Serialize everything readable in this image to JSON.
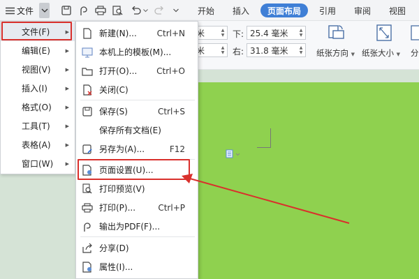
{
  "toolbar": {
    "file_label": "文件",
    "tabs": [
      "开始",
      "插入",
      "页面布局",
      "引用",
      "审阅",
      "视图"
    ],
    "active_tab": "页面布局",
    "accent_color": "#3f7fd6"
  },
  "ribbon": {
    "margin_top_value": "米",
    "margin_bottom_label": "下:",
    "margin_bottom_value": "25.4 毫米",
    "margin_left_value": "米",
    "margin_right_label": "右:",
    "margin_right_value": "31.8 毫米",
    "paper_orientation_label": "纸张方向",
    "paper_size_label": "纸张大小",
    "columns_label": "分"
  },
  "menu": {
    "items": [
      {
        "label": "文件(F)",
        "icon": "chevron-right"
      },
      {
        "label": "编辑(E)",
        "icon": "chevron-right"
      },
      {
        "label": "视图(V)",
        "icon": "chevron-right"
      },
      {
        "label": "插入(I)",
        "icon": "chevron-right"
      },
      {
        "label": "格式(O)",
        "icon": "chevron-right"
      },
      {
        "label": "工具(T)",
        "icon": "chevron-right"
      },
      {
        "label": "表格(A)",
        "icon": "chevron-right"
      },
      {
        "label": "窗口(W)",
        "icon": "chevron-right"
      }
    ],
    "selected": "文件(F)"
  },
  "file_menu": {
    "items": [
      {
        "label": "新建(N)...",
        "shortcut": "Ctrl+N",
        "icon": "new-doc-icon"
      },
      {
        "label": "本机上的模板(M)...",
        "shortcut": "",
        "icon": "template-icon"
      },
      {
        "label": "打开(O)...",
        "shortcut": "Ctrl+O",
        "icon": "open-folder-icon"
      },
      {
        "label": "关闭(C)",
        "shortcut": "",
        "icon": "close-doc-icon"
      },
      {
        "label": "保存(S)",
        "shortcut": "Ctrl+S",
        "icon": "save-icon"
      },
      {
        "label": "保存所有文档(E)",
        "shortcut": "",
        "icon": ""
      },
      {
        "label": "另存为(A)...",
        "shortcut": "F12",
        "icon": "save-as-icon"
      },
      {
        "label": "页面设置(U)...",
        "shortcut": "",
        "icon": "page-setup-icon"
      },
      {
        "label": "打印预览(V)",
        "shortcut": "",
        "icon": "print-preview-icon"
      },
      {
        "label": "打印(P)...",
        "shortcut": "Ctrl+P",
        "icon": "print-icon"
      },
      {
        "label": "输出为PDF(F)...",
        "shortcut": "",
        "icon": "pdf-icon"
      },
      {
        "label": "分享(D)",
        "shortcut": "",
        "icon": "share-icon"
      },
      {
        "label": "属性(I)...",
        "shortcut": "",
        "icon": "properties-icon"
      }
    ],
    "highlighted": "页面设置(U)..."
  },
  "annotation": {
    "color": "#d9302c"
  }
}
